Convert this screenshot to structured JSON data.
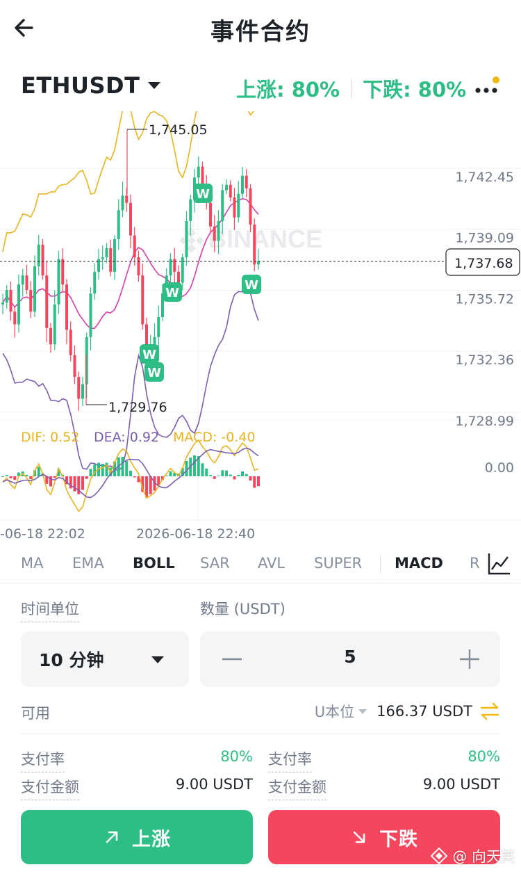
{
  "header": {
    "title": "事件合约",
    "back_icon": "arrow-left-icon"
  },
  "pair": {
    "symbol": "ETHUSDT",
    "up_rate": "上涨: 80%",
    "down_rate": "下跌: 80%",
    "more_icon": "more-dots-icon",
    "notification_dot_color": "#f0b90b"
  },
  "chart_data": {
    "type": "candlestick",
    "current_price": "1,737.68",
    "high_label": "1,745.05",
    "low_label": "1,729.76",
    "price_ticks": [
      "1,742.45",
      "1,739.09",
      "1,735.72",
      "1,732.36",
      "1,728.99"
    ],
    "price_tick_values": [
      1742.45,
      1739.09,
      1735.72,
      1732.36,
      1728.99
    ],
    "x_labels": [
      "-06-18 22:02",
      "2026-06-18 22:40"
    ],
    "watermark": "BINANCE",
    "marker_label": "W",
    "macd": {
      "dif": "DIF: 0.52",
      "dea": "DEA: 0.92",
      "macd": "MACD: -0.40",
      "zero_label": "0.00"
    },
    "colors": {
      "up": "#2ebd85",
      "down": "#f6465d",
      "boll_band": "#e8b422",
      "boll_mid": "#d63fa8",
      "lower": "#7b5eb0",
      "dif": "#e8b422",
      "dea": "#7b5eb0"
    }
  },
  "indicators": {
    "tabs": [
      "MA",
      "EMA",
      "BOLL",
      "SAR",
      "AVL",
      "SUPER",
      "MACD",
      "R"
    ],
    "active_main": "BOLL",
    "active_sub": "MACD",
    "settings_icon": "chart-line-icon"
  },
  "form": {
    "time_label": "时间单位",
    "time_value": "10 分钟",
    "qty_label": "数量 (USDT)",
    "qty_value": "5",
    "available_label": "可用",
    "unit_label": "U本位",
    "available_value": "166.37 USDT"
  },
  "pay": {
    "left": {
      "rate_label": "支付率",
      "rate_value": "80%",
      "amount_label": "支付金额",
      "amount_value": "9.00 USDT"
    },
    "right": {
      "rate_label": "支付率",
      "rate_value": "80%",
      "amount_label": "支付金额",
      "amount_value": "9.00 USDT"
    }
  },
  "actions": {
    "up_label": "上涨",
    "down_label": "下跌"
  },
  "watermark_author": "@ 向天笑",
  "colors": {
    "green": "#2ebd85",
    "red": "#f6465d",
    "yellow": "#f0b90b"
  }
}
